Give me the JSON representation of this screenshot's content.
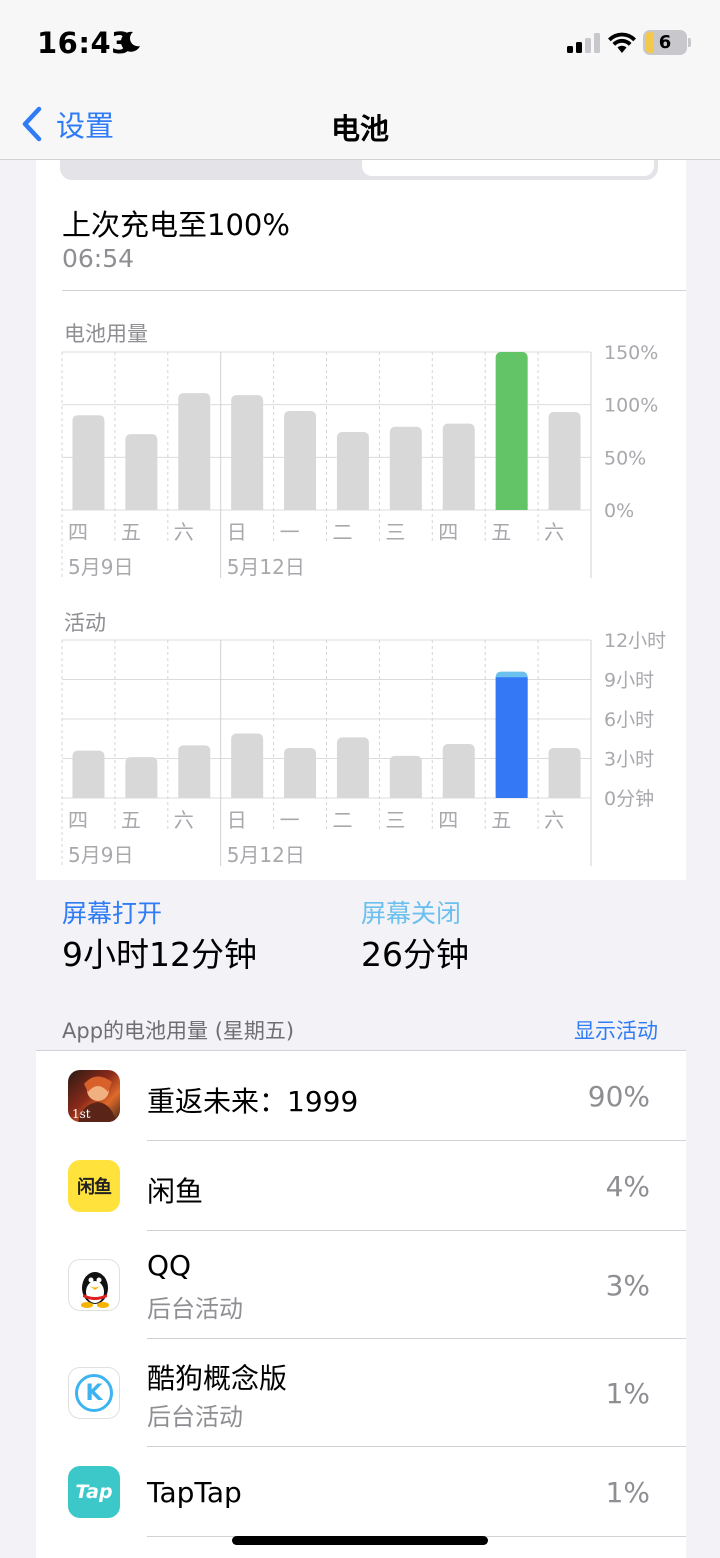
{
  "status_bar": {
    "time": "16:43",
    "battery_level": "6"
  },
  "nav": {
    "back_label": "设置",
    "title": "电池"
  },
  "last_charge": {
    "label": "上次充电至100%",
    "time": "06:54"
  },
  "battery_chart": {
    "label": "电池用量",
    "y_ticks": [
      "150%",
      "100%",
      "50%",
      "0%"
    ],
    "day_labels": [
      "四",
      "五",
      "六",
      "日",
      "一",
      "二",
      "三",
      "四",
      "五",
      "六"
    ],
    "date_labels": [
      "5月9日",
      "5月12日"
    ]
  },
  "activity_chart": {
    "label": "活动",
    "y_ticks": [
      "12小时",
      "9小时",
      "6小时",
      "3小时",
      "0分钟"
    ],
    "day_labels": [
      "四",
      "五",
      "六",
      "日",
      "一",
      "二",
      "三",
      "四",
      "五",
      "六"
    ],
    "date_labels": [
      "5月9日",
      "5月12日"
    ]
  },
  "chart_data": [
    {
      "type": "bar",
      "ylabel": "电池用量",
      "categories": [
        "四",
        "五",
        "六",
        "日",
        "一",
        "二",
        "三",
        "四",
        "五",
        "六"
      ],
      "values": [
        90,
        72,
        111,
        109,
        94,
        74,
        79,
        82,
        150,
        93
      ],
      "ylim": [
        0,
        150
      ],
      "highlight_index": 8,
      "colors": {
        "normal": "#d8d8d8",
        "highlight": "#62c466"
      }
    },
    {
      "type": "bar",
      "ylabel": "活动",
      "unit": "hours",
      "categories": [
        "四",
        "五",
        "六",
        "日",
        "一",
        "二",
        "三",
        "四",
        "五",
        "六"
      ],
      "values": [
        3.6,
        3.1,
        4.0,
        4.9,
        3.8,
        4.6,
        3.2,
        4.1,
        9.6,
        3.8
      ],
      "ylim": [
        0,
        12
      ],
      "highlight_index": 8,
      "highlight_screen_off_hours": 0.43,
      "colors": {
        "normal": "#d8d8d8",
        "screen_on": "#3478f6",
        "screen_off": "#6cc0ee"
      }
    }
  ],
  "screen": {
    "on_label": "屏幕打开",
    "on_value": "9小时12分钟",
    "off_label": "屏幕关闭",
    "off_value": "26分钟"
  },
  "app_section": {
    "title": "App的电池用量 (星期五)",
    "link": "显示活动"
  },
  "apps": [
    {
      "name": "重返未来：1999",
      "sub": "",
      "pct": "90%",
      "icon": "reverse-1999-icon"
    },
    {
      "name": "闲鱼",
      "sub": "",
      "pct": "4%",
      "icon": "xianyu-icon",
      "icon_text": "闲鱼"
    },
    {
      "name": "QQ",
      "sub": "后台活动",
      "pct": "3%",
      "icon": "qq-penguin-icon"
    },
    {
      "name": "酷狗概念版",
      "sub": "后台活动",
      "pct": "1%",
      "icon": "kugou-icon",
      "icon_text": "K"
    },
    {
      "name": "TapTap",
      "sub": "",
      "pct": "1%",
      "icon": "taptap-icon",
      "icon_text": "Tap"
    }
  ],
  "colors": {
    "accent": "#2f7cf6",
    "battery_green": "#62c466",
    "activity_blue": "#3478f6",
    "screen_off": "#6cc0ee"
  }
}
